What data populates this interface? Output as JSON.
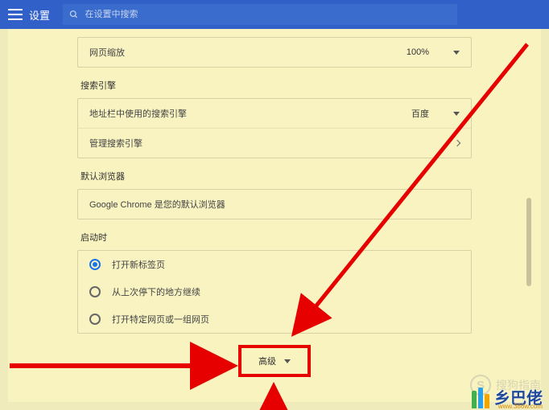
{
  "topbar": {
    "title": "设置",
    "search_placeholder": "在设置中搜索"
  },
  "zoom": {
    "label": "网页缩放",
    "value": "100%"
  },
  "search_engine": {
    "section": "搜索引擎",
    "addressbar_label": "地址栏中使用的搜索引擎",
    "addressbar_value": "百度",
    "manage_label": "管理搜索引擎"
  },
  "default_browser": {
    "section": "默认浏览器",
    "text": "Google Chrome 是您的默认浏览器"
  },
  "startup": {
    "section": "启动时",
    "options": [
      "打开新标签页",
      "从上次停下的地方继续",
      "打开特定网页或一组网页"
    ]
  },
  "advanced": {
    "label": "高级"
  },
  "watermark": {
    "text": "搜狗指南"
  },
  "footer": {
    "zh": "乡巴佬",
    "url": "www.386w.com"
  }
}
